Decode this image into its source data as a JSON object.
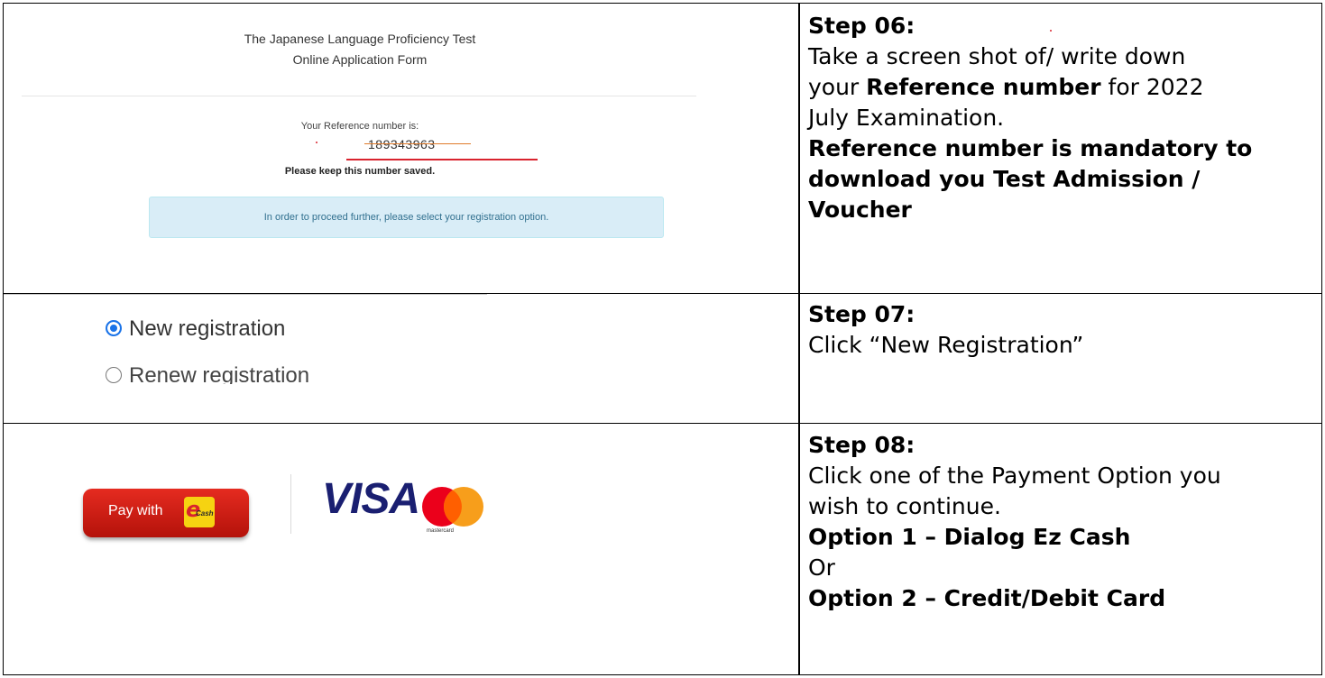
{
  "step06": {
    "heading": "Step 06:",
    "line1": "Take a screen shot of/ write down",
    "line2_pre": "your ",
    "line2_bold": "Reference number",
    "line2_post": " for 2022",
    "line3": "July Examination.",
    "bold1": "Reference number is mandatory to",
    "bold2": "download you Test Admission /",
    "bold3": "Voucher"
  },
  "form": {
    "title_line1": "The Japanese Language Proficiency Test",
    "title_line2": "Online Application Form",
    "ref_label": "Your Reference number is:",
    "ref_number": "189343963",
    "keep_note": "Please keep this number saved.",
    "info_message": "In order to proceed further, please select your registration option."
  },
  "step07": {
    "heading": "Step 07:",
    "text": "Click “New Registration”"
  },
  "registration": {
    "option_new": "New registration",
    "option_renew": "Renew registration",
    "selected": "New registration"
  },
  "step08": {
    "heading": "Step 08:",
    "line1": "Click one of the Payment Option you",
    "line2": "wish to continue.",
    "option1": "Option 1 – Dialog Ez Cash",
    "or": "Or",
    "option2": "Option 2 – Credit/Debit Card"
  },
  "payment": {
    "pay_with": "Pay with",
    "ez_letter": "e",
    "ez_cash": "Cash",
    "visa": "VISA",
    "mastercard": "mastercard"
  },
  "colors": {
    "ez_red": "#d9232e",
    "ez_yellow": "#f6d311",
    "visa_blue": "#1a1f71",
    "mc_red": "#eb001b",
    "mc_orange": "#f79e1b",
    "radio_blue": "#1a73e8",
    "info_bg": "#d9edf7"
  }
}
